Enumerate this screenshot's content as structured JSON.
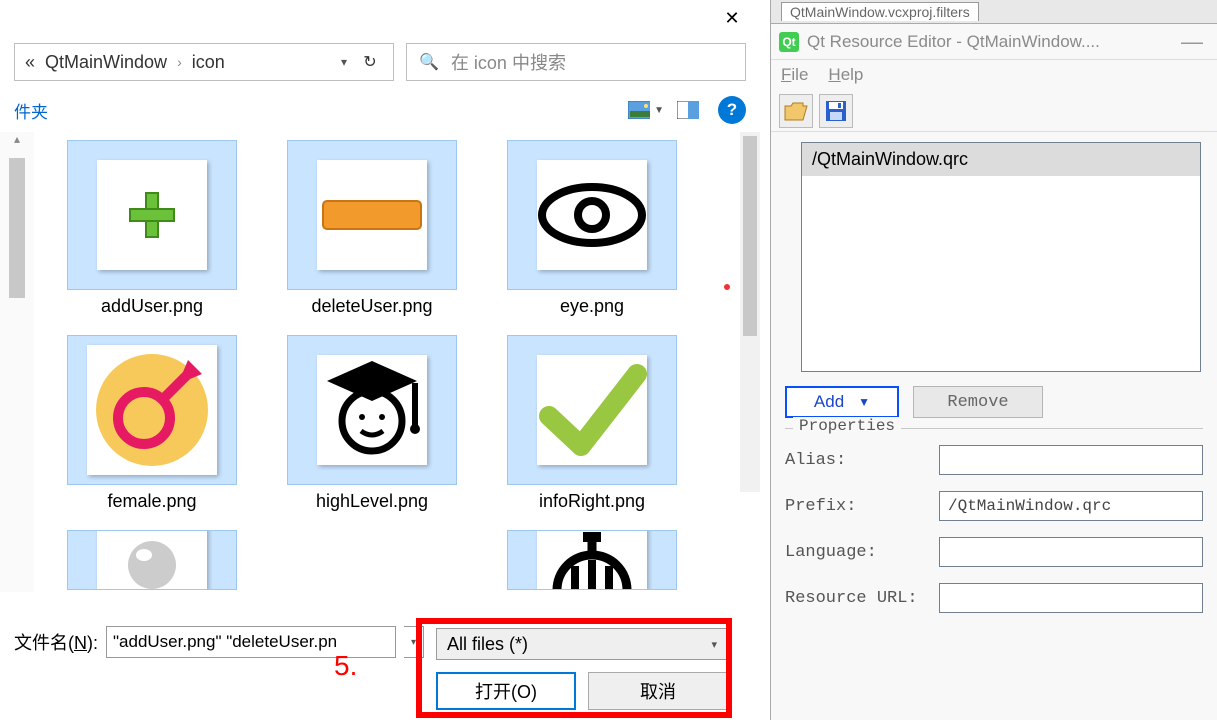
{
  "file_dialog": {
    "breadcrumb": {
      "sep": "«",
      "part1": "QtMainWindow",
      "chev": "›",
      "part2": "icon"
    },
    "refresh_glyph": "↻",
    "search_placeholder": "在 icon 中搜索",
    "new_folder_label": "件夹",
    "help_glyph": "?",
    "files": [
      {
        "name": "addUser.png"
      },
      {
        "name": "deleteUser.png"
      },
      {
        "name": "eye.png"
      },
      {
        "name": "female.png"
      },
      {
        "name": "highLevel.png"
      },
      {
        "name": "infoRight.png"
      }
    ],
    "filename_label_pre": "文件名(",
    "filename_label_u": "N",
    "filename_label_post": "):",
    "filename_value": "\"addUser.png\" \"deleteUser.pn",
    "filetype_value": "All files  (*)",
    "open_label": "打开(O)",
    "cancel_label": "取消",
    "step5": "5."
  },
  "qt_editor": {
    "project_tab": "QtMainWindow.vcxproj.filters",
    "window_title": "Qt Resource Editor - QtMainWindow....",
    "menu": {
      "file": "File",
      "help": "Help"
    },
    "resource_item": "/QtMainWindow.qrc",
    "add_label": "Add",
    "remove_label": "Remove",
    "props_title": "Properties",
    "alias_label": "Alias:",
    "prefix_label": "Prefix:",
    "prefix_value": "/QtMainWindow.qrc",
    "language_label": "Language:",
    "resurl_label": "Resource URL:"
  }
}
